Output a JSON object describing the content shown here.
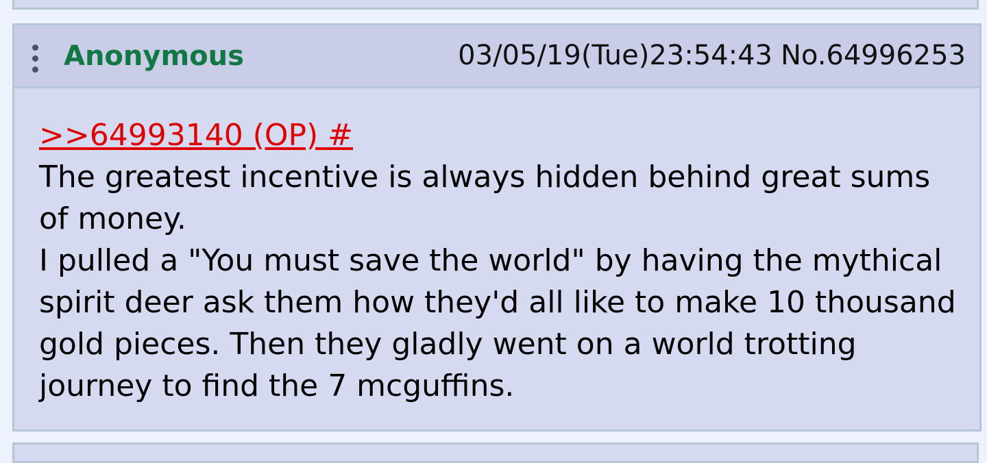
{
  "post": {
    "name": "Anonymous",
    "datetime": "03/05/19(Tue)23:54:43",
    "number": "No.64996253",
    "quote_link": ">>64993140 (OP) #",
    "body_lines": [
      "The greatest incentive is always hidden behind great sums of money.",
      "I pulled a \"You must save the world\" by having the mythical spirit deer ask them how they'd all like to make 10 thousand gold pieces. Then they gladly went on a world trotting journey to find the 7 mcguffins."
    ]
  },
  "icons": {
    "menu": "vertical-ellipsis-icon"
  },
  "colors": {
    "name": "#117743",
    "quote_link": "#dd0000",
    "post_background": "#d6daf0",
    "header_background": "#c9cde8",
    "border": "#b7c5d9",
    "page_background": "#eef2ff"
  }
}
